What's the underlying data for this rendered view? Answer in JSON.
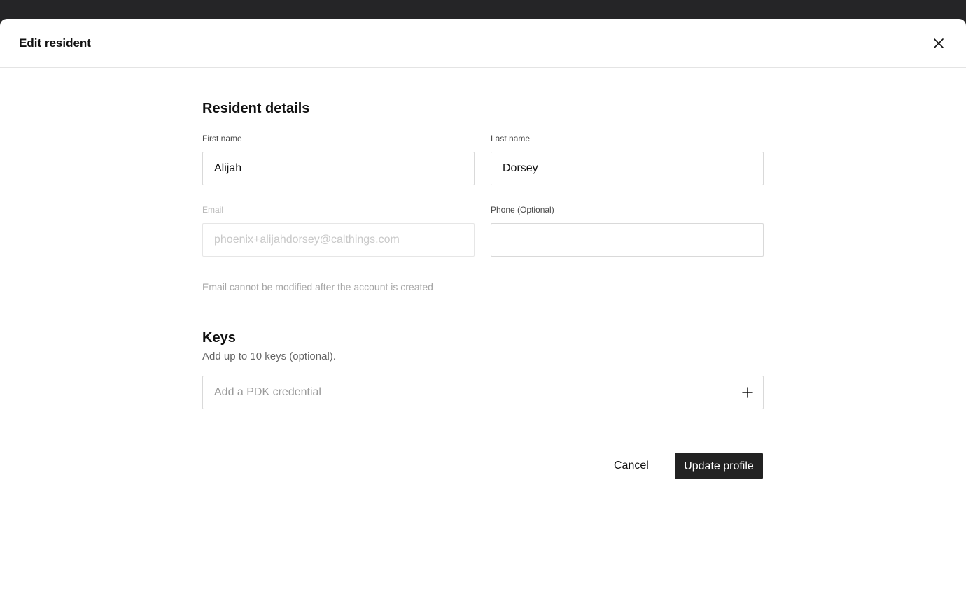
{
  "modal": {
    "title": "Edit resident",
    "close_icon": "close-icon"
  },
  "resident_details": {
    "title": "Resident details",
    "first_name": {
      "label": "First name",
      "value": "Alijah"
    },
    "last_name": {
      "label": "Last name",
      "value": "Dorsey"
    },
    "email": {
      "label": "Email",
      "value": "phoenix+alijahdorsey@calthings.com",
      "helper": "Email cannot be modified after the account is created",
      "disabled": true
    },
    "phone": {
      "label": "Phone (Optional)",
      "value": ""
    }
  },
  "keys": {
    "title": "Keys",
    "subtitle": "Add up to 10 keys (optional).",
    "input_placeholder": "Add a PDK credential",
    "add_icon": "plus-icon"
  },
  "actions": {
    "cancel_label": "Cancel",
    "update_label": "Update profile"
  },
  "colors": {
    "primary_button": "#222222",
    "border": "#d9d9d9",
    "disabled_text": "#c9c9c9"
  }
}
